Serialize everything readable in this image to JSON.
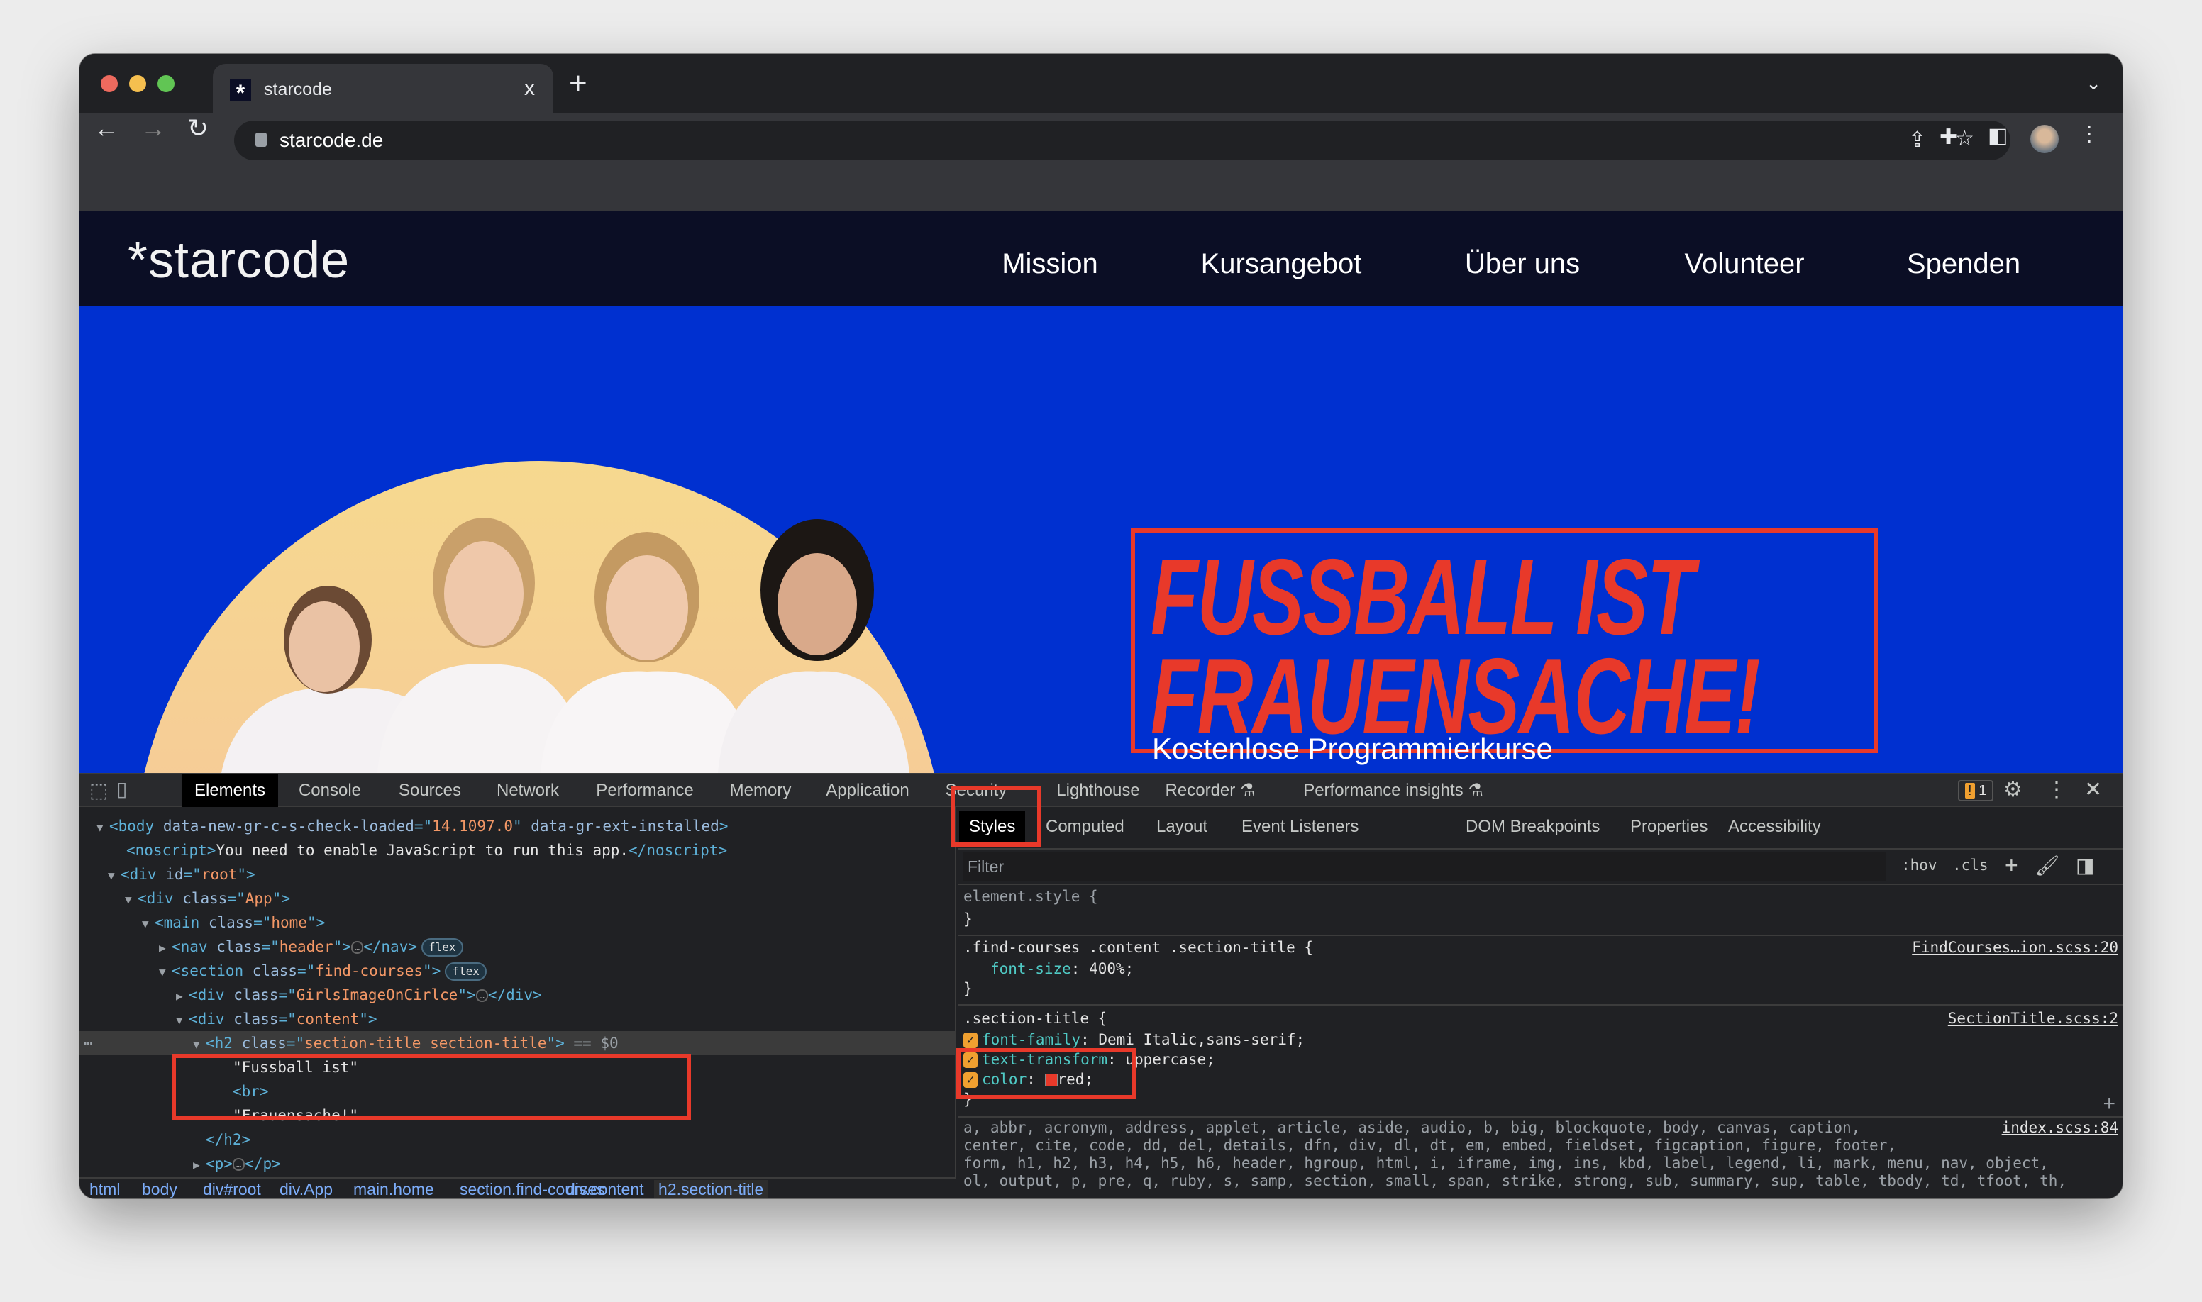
{
  "browser": {
    "tab_title": "starcode",
    "url": "starcode.de",
    "new_tab": "+",
    "tab_close": "x"
  },
  "site": {
    "logo": "*starcode",
    "nav": [
      "Mission",
      "Kursangebot",
      "Über uns",
      "Volunteer",
      "Spenden"
    ],
    "headline": [
      "FUSSBALL IST",
      "FRAUENSACHE!"
    ],
    "headline_color": "#e8392a",
    "hero_bg": "#0030d0",
    "subtitle": "Kostenlose Programmierkurse"
  },
  "devtools": {
    "tabs": [
      "Elements",
      "Console",
      "Sources",
      "Network",
      "Performance",
      "Memory",
      "Application",
      "Security",
      "Lighthouse",
      "Recorder ⚗",
      "Performance insights ⚗"
    ],
    "selected_tab": "Elements",
    "issues_count": "1",
    "dom_rows": [
      {
        "toggle": "open",
        "parts": [
          [
            "tg",
            "<body "
          ],
          [
            "an",
            "data-new-gr-c-s-check-loaded"
          ],
          [
            "tg",
            "=\""
          ],
          [
            "av",
            "14.1097.0"
          ],
          [
            "tg",
            "\" "
          ],
          [
            "an",
            "data-gr-ext-installed"
          ],
          [
            "tg",
            ">"
          ]
        ]
      },
      {
        "toggle": null,
        "parts": [
          [
            "tg",
            "<noscript>"
          ],
          [
            "tx",
            "You need to enable JavaScript to run this app."
          ],
          [
            "tg",
            "</noscript>"
          ]
        ]
      },
      {
        "toggle": "open",
        "parts": [
          [
            "tg",
            "<div "
          ],
          [
            "an",
            "id"
          ],
          [
            "tg",
            "=\""
          ],
          [
            "av",
            "root"
          ],
          [
            "tg",
            "\">"
          ]
        ]
      },
      {
        "toggle": "open",
        "parts": [
          [
            "tg",
            "<div "
          ],
          [
            "an",
            "class"
          ],
          [
            "tg",
            "=\""
          ],
          [
            "av",
            "App"
          ],
          [
            "tg",
            "\">"
          ]
        ]
      },
      {
        "toggle": "open",
        "parts": [
          [
            "tg",
            "<main "
          ],
          [
            "an",
            "class"
          ],
          [
            "tg",
            "=\""
          ],
          [
            "av",
            "home"
          ],
          [
            "tg",
            "\">"
          ]
        ]
      },
      {
        "toggle": "closed",
        "parts": [
          [
            "tg",
            "<nav "
          ],
          [
            "an",
            "class"
          ],
          [
            "tg",
            "=\""
          ],
          [
            "av",
            "header"
          ],
          [
            "tg",
            "\">"
          ],
          [
            "ell",
            "…"
          ],
          [
            "tg",
            "</nav>"
          ],
          [
            "pill",
            "flex"
          ]
        ]
      },
      {
        "toggle": "open",
        "parts": [
          [
            "tg",
            "<section "
          ],
          [
            "an",
            "class"
          ],
          [
            "tg",
            "=\""
          ],
          [
            "av",
            "find-courses"
          ],
          [
            "tg",
            "\">"
          ],
          [
            "pill",
            "flex"
          ]
        ]
      },
      {
        "toggle": "closed",
        "parts": [
          [
            "tg",
            "<div "
          ],
          [
            "an",
            "class"
          ],
          [
            "tg",
            "=\""
          ],
          [
            "av",
            "GirlsImageOnCirlce"
          ],
          [
            "tg",
            "\">"
          ],
          [
            "ell",
            "…"
          ],
          [
            "tg",
            "</div>"
          ]
        ]
      },
      {
        "toggle": "open",
        "parts": [
          [
            "tg",
            "<div "
          ],
          [
            "an",
            "class"
          ],
          [
            "tg",
            "=\""
          ],
          [
            "av",
            "content"
          ],
          [
            "tg",
            "\">"
          ]
        ]
      },
      {
        "toggle": "open",
        "selected": true,
        "parts": [
          [
            "tg",
            "<h2 "
          ],
          [
            "an",
            "class"
          ],
          [
            "tg",
            "=\""
          ],
          [
            "av",
            "section-title section-title"
          ],
          [
            "tg",
            "\">"
          ],
          [
            "eq",
            " == $0"
          ]
        ]
      },
      {
        "toggle": null,
        "parts": [
          [
            "tx",
            "\"Fussball ist\""
          ]
        ]
      },
      {
        "toggle": null,
        "parts": [
          [
            "tg",
            "<br>"
          ]
        ]
      },
      {
        "toggle": null,
        "parts": [
          [
            "tx",
            "\"Frauensache!\""
          ]
        ]
      },
      {
        "toggle": null,
        "parts": [
          [
            "tg",
            "</h2>"
          ]
        ]
      },
      {
        "toggle": "closed",
        "parts": [
          [
            "tg",
            "<p>"
          ],
          [
            "ell",
            "…"
          ],
          [
            "tg",
            "</p>"
          ]
        ]
      }
    ],
    "breadcrumbs": [
      "html",
      "body",
      "div#root",
      "div.App",
      "main.home",
      "section.find-courses",
      "div.content",
      "h2.section-title"
    ],
    "styles": {
      "subtabs": [
        "Styles",
        "Computed",
        "Layout",
        "Event Listeners",
        "DOM Breakpoints",
        "Properties",
        "Accessibility"
      ],
      "filter_placeholder": "Filter",
      "hov": ":hov",
      "cls": ".cls",
      "element_style_open": "element.style {",
      "close_brace": "}",
      "rule1": {
        "selector": ".find-courses .content .section-title {",
        "source": "FindCourses…ion.scss:20",
        "prop": "font-size",
        "value": "400%;"
      },
      "rule2": {
        "selector": ".section-title {",
        "source": "SectionTitle.scss:2",
        "props": [
          {
            "name": "font-family",
            "value": "Demi Italic,sans-serif;"
          },
          {
            "name": "text-transform",
            "value": "uppercase;"
          },
          {
            "name": "color",
            "value": "red;",
            "swatch": "#e8392a"
          }
        ]
      },
      "rule3": {
        "source": "index.scss:84",
        "lines": [
          "a, abbr, acronym, address, applet, article, aside, audio, b, big, blockquote, body, canvas, caption,",
          "center, cite, code, dd, del, details, dfn, div, dl, dt, em, embed, fieldset, figcaption, figure, footer,",
          "form, h1, h2, h3, h4, h5, h6, header, hgroup, html, i, iframe, img, ins, kbd, label, legend, li, mark, menu, nav, object,",
          "ol, output, p, pre, q, ruby, s, samp, section, small, span, strike, strong, sub, summary, sup, table, tbody, td, tfoot, th,"
        ]
      }
    }
  }
}
